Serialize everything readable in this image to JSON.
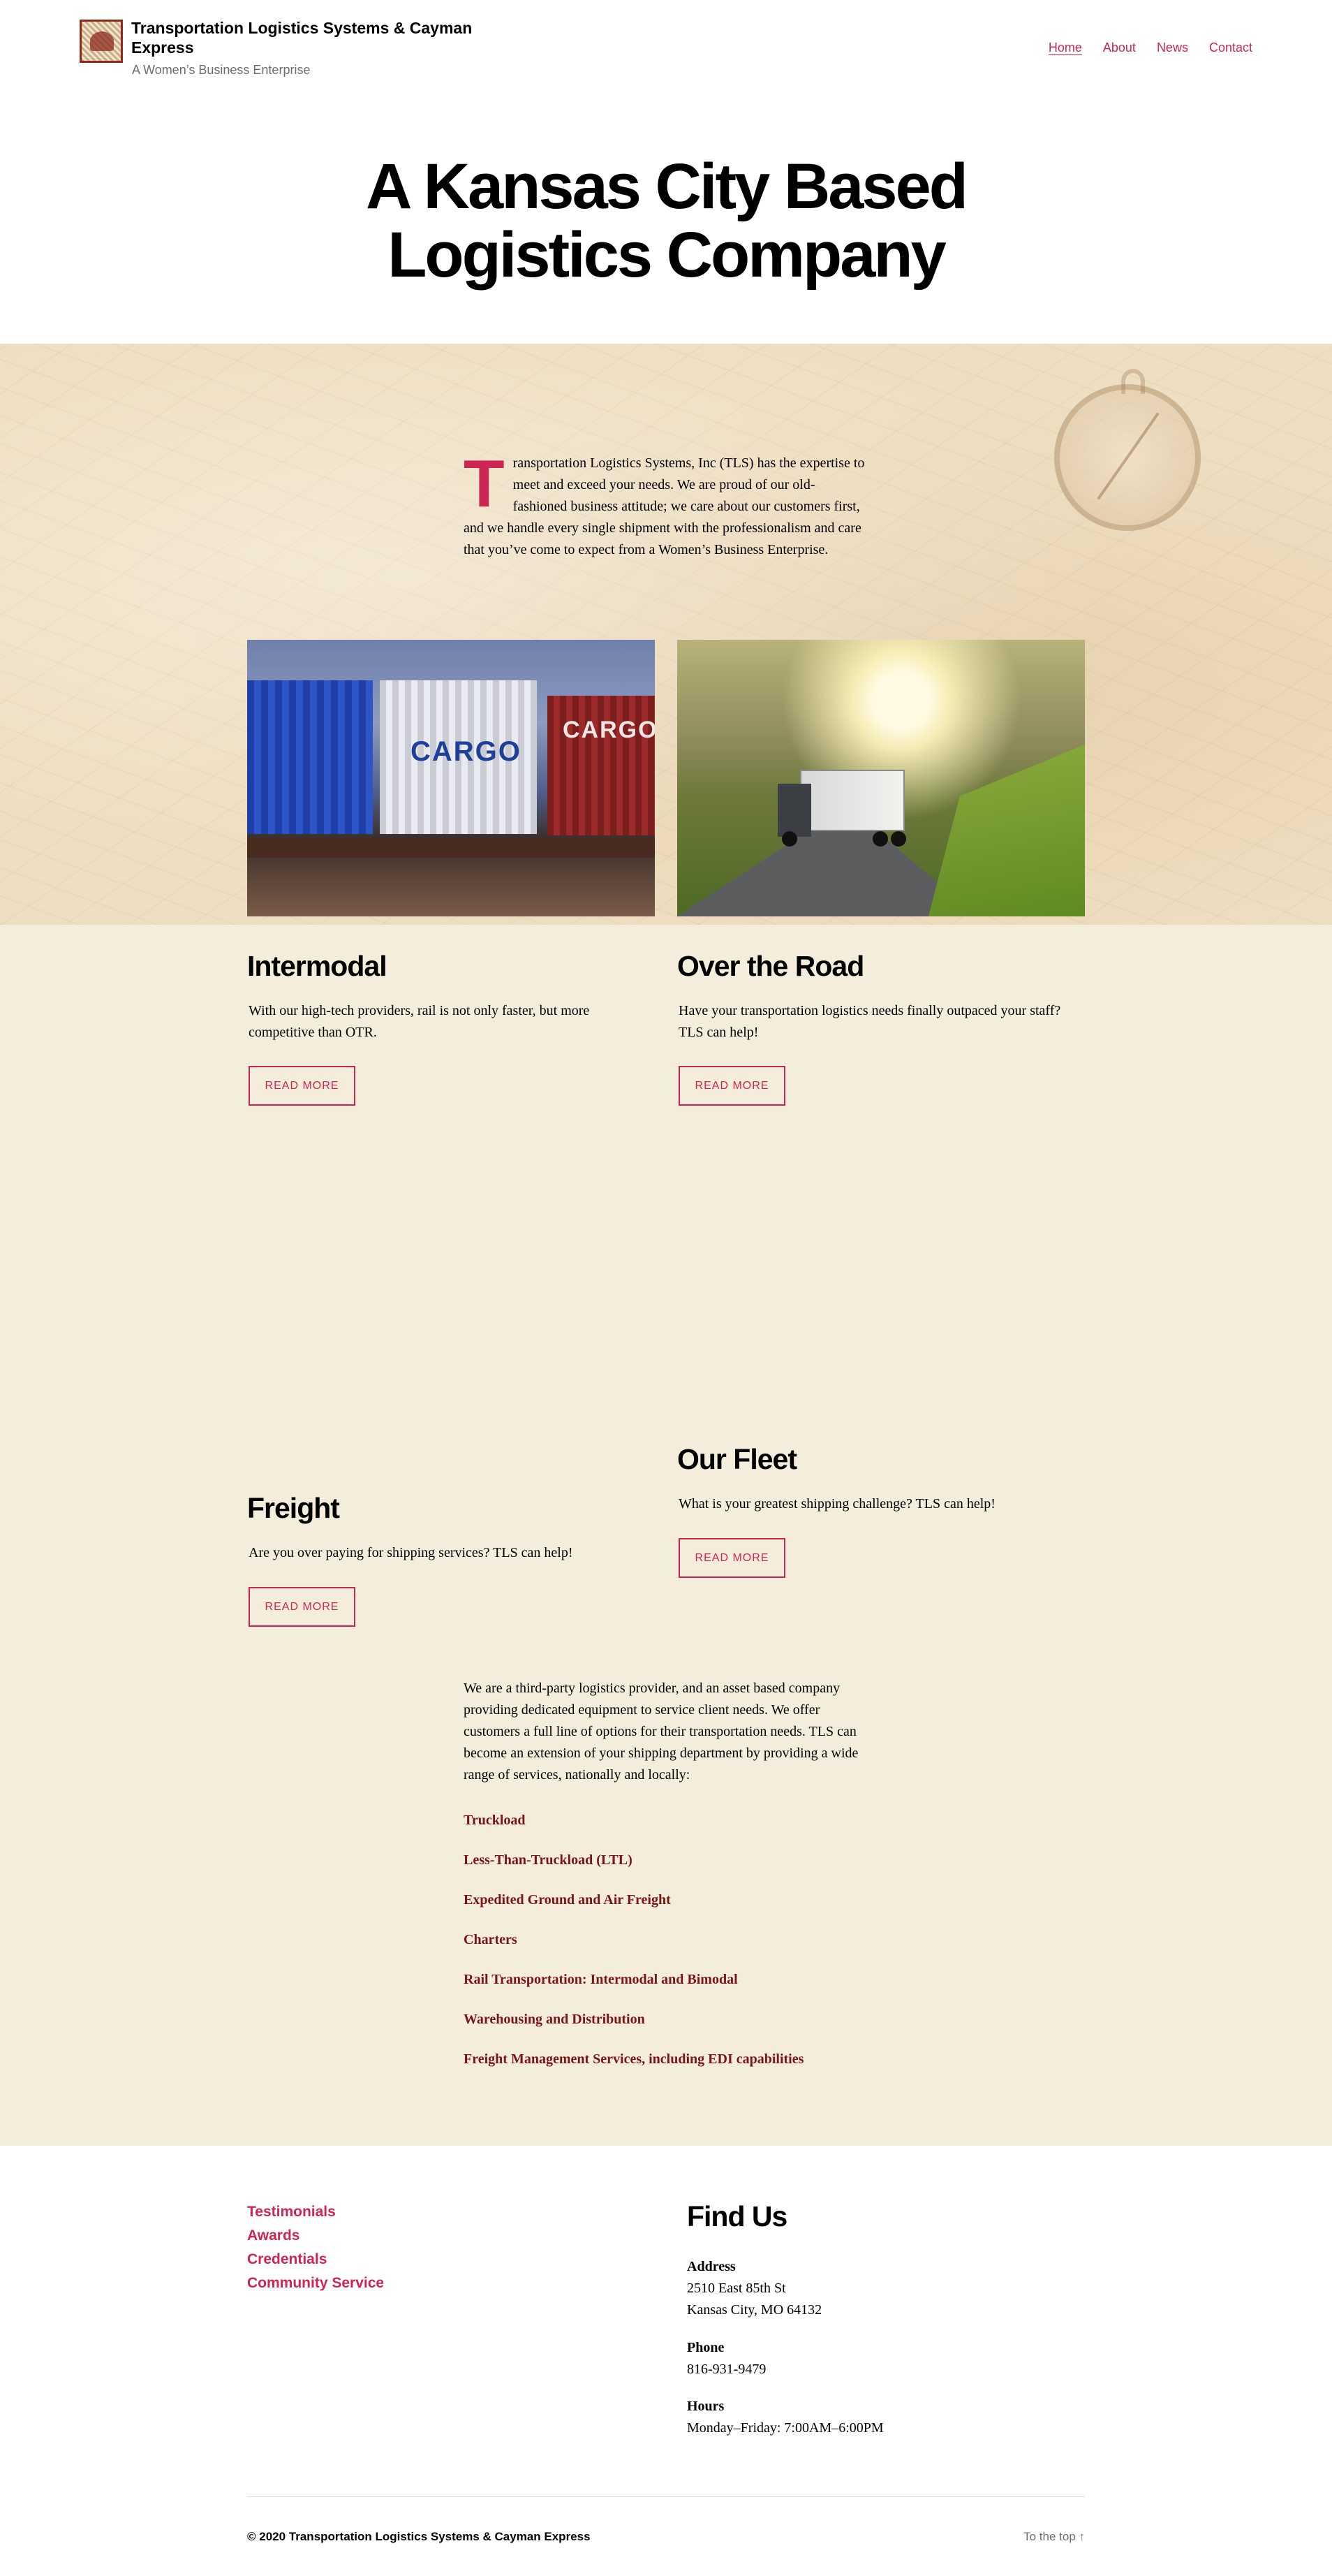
{
  "header": {
    "site_title": "Transportation Logistics Systems & Cayman Express",
    "site_description": "A Women’s Business Enterprise",
    "nav": [
      {
        "label": "Home"
      },
      {
        "label": "About"
      },
      {
        "label": "News"
      },
      {
        "label": "Contact"
      }
    ]
  },
  "hero": {
    "title_line1": "A Kansas City Based",
    "title_line2": "Logistics Company"
  },
  "intro": {
    "dropcap": "T",
    "text": "ransportation Logistics Systems, Inc (TLS) has the expertise to meet and exceed your needs. We are proud of our old-fashioned business attitude; we care about our customers first, and we handle every single shipment with the professionalism and care that you’ve come to expect from a Women’s Business Enterprise."
  },
  "photos": {
    "train_labels": [
      "CARGO",
      "CARGO"
    ]
  },
  "cards": [
    {
      "title": "Intermodal",
      "text": "With our high-tech providers, rail is not only faster, but more competitive than OTR.",
      "button": "READ MORE"
    },
    {
      "title": "Over the Road",
      "text": "Have your transportation logistics needs finally outpaced your staff? TLS can help!",
      "button": "READ MORE"
    },
    {
      "title": "Freight",
      "text": "Are you over paying for shipping services? TLS can help!",
      "button": "READ MORE"
    },
    {
      "title": "Our Fleet",
      "text": "What is your greatest shipping challenge? TLS can help!",
      "button": "READ MORE"
    }
  ],
  "services": {
    "intro": "We are a third-party logistics provider, and an asset based company providing dedicated equipment to service client needs. We offer customers a full line of options for their transportation needs. TLS can become an extension of your shipping department by providing a wide range of services, nationally and locally:",
    "items": [
      "Truckload",
      "Less-Than-Truckload (LTL)",
      "Expedited Ground and Air Freight",
      "Charters",
      "Rail Transportation: Intermodal and Bimodal",
      "Warehousing and Distribution",
      "Freight Management Services, including EDI capabilities"
    ]
  },
  "footer": {
    "links": [
      "Testimonials",
      "Awards",
      "Credentials",
      "Community Service"
    ],
    "find_us": {
      "title": "Find Us",
      "address_label": "Address",
      "address_line1": "2510 East 85th St",
      "address_line2": "Kansas City, MO 64132",
      "phone_label": "Phone",
      "phone": "816-931-9479",
      "hours_label": "Hours",
      "hours": "Monday–Friday: 7:00AM–6:00PM"
    },
    "copyright": "© 2020 Transportation Logistics Systems & Cayman Express",
    "to_top": "To the top ↑"
  },
  "colors": {
    "accent": "#cd2653",
    "service_link": "#7a1418",
    "cream_bg": "#f4eddb"
  }
}
